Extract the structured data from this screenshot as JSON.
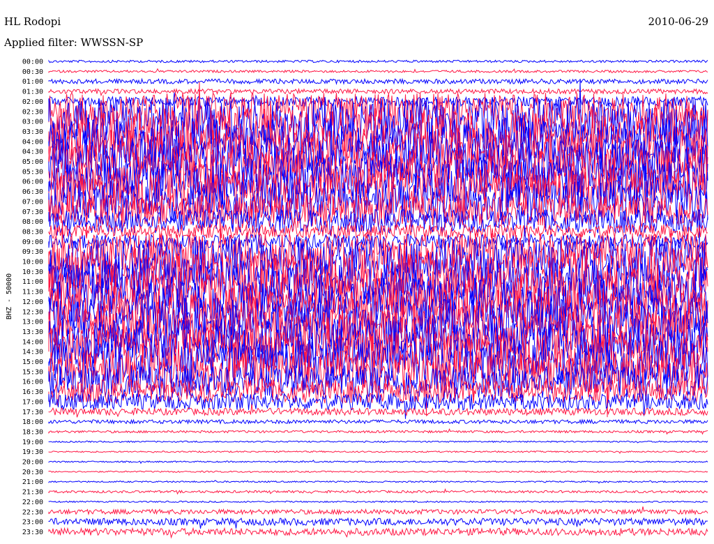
{
  "header": {
    "station": "HL Rodopi",
    "date": "2010-06-29",
    "filter": "Applied filter: WWSSN-SP"
  },
  "chart_data": {
    "type": "line",
    "title": "HL Rodopi",
    "subtitle": "Applied filter: WWSSN-SP",
    "ylabel": "BHZ - 50000",
    "xlabel": "",
    "trace_colors": [
      "#0000ff",
      "#ff1744"
    ],
    "rows": [
      {
        "label": "00:00",
        "level": 0.05,
        "color": "blue"
      },
      {
        "label": "00:30",
        "level": 0.05,
        "color": "red"
      },
      {
        "label": "01:00",
        "level": 0.1,
        "color": "blue"
      },
      {
        "label": "01:30",
        "level": 0.1,
        "color": "red"
      },
      {
        "label": "02:00",
        "level": 0.2,
        "color": "blue"
      },
      {
        "label": "02:30",
        "level": 0.8,
        "color": "red"
      },
      {
        "label": "03:00",
        "level": 1.0,
        "color": "blue"
      },
      {
        "label": "03:30",
        "level": 1.0,
        "color": "red"
      },
      {
        "label": "04:00",
        "level": 1.0,
        "color": "blue"
      },
      {
        "label": "04:30",
        "level": 1.0,
        "color": "red"
      },
      {
        "label": "05:00",
        "level": 1.0,
        "color": "blue"
      },
      {
        "label": "05:30",
        "level": 1.0,
        "color": "red"
      },
      {
        "label": "06:00",
        "level": 1.0,
        "color": "blue"
      },
      {
        "label": "06:30",
        "level": 1.0,
        "color": "red"
      },
      {
        "label": "07:00",
        "level": 0.9,
        "color": "blue"
      },
      {
        "label": "07:30",
        "level": 0.7,
        "color": "red"
      },
      {
        "label": "08:00",
        "level": 0.5,
        "color": "blue"
      },
      {
        "label": "08:30",
        "level": 0.3,
        "color": "red"
      },
      {
        "label": "09:00",
        "level": 0.3,
        "color": "blue"
      },
      {
        "label": "09:30",
        "level": 0.8,
        "color": "red"
      },
      {
        "label": "10:00",
        "level": 1.0,
        "color": "blue"
      },
      {
        "label": "10:30",
        "level": 1.0,
        "color": "red"
      },
      {
        "label": "11:00",
        "level": 1.0,
        "color": "blue"
      },
      {
        "label": "11:30",
        "level": 1.0,
        "color": "red"
      },
      {
        "label": "12:00",
        "level": 1.0,
        "color": "blue"
      },
      {
        "label": "12:30",
        "level": 1.0,
        "color": "red"
      },
      {
        "label": "13:00",
        "level": 1.0,
        "color": "blue"
      },
      {
        "label": "13:30",
        "level": 1.0,
        "color": "red"
      },
      {
        "label": "14:00",
        "level": 1.0,
        "color": "blue"
      },
      {
        "label": "14:30",
        "level": 1.0,
        "color": "red"
      },
      {
        "label": "15:00",
        "level": 1.0,
        "color": "blue"
      },
      {
        "label": "15:30",
        "level": 0.9,
        "color": "red"
      },
      {
        "label": "16:00",
        "level": 0.7,
        "color": "blue"
      },
      {
        "label": "16:30",
        "level": 0.5,
        "color": "red"
      },
      {
        "label": "17:00",
        "level": 0.35,
        "color": "blue"
      },
      {
        "label": "17:30",
        "level": 0.15,
        "color": "red"
      },
      {
        "label": "18:00",
        "level": 0.08,
        "color": "blue"
      },
      {
        "label": "18:30",
        "level": 0.05,
        "color": "red"
      },
      {
        "label": "19:00",
        "level": 0.03,
        "color": "blue"
      },
      {
        "label": "19:30",
        "level": 0.03,
        "color": "red"
      },
      {
        "label": "20:00",
        "level": 0.03,
        "color": "blue"
      },
      {
        "label": "20:30",
        "level": 0.03,
        "color": "red"
      },
      {
        "label": "21:00",
        "level": 0.03,
        "color": "blue"
      },
      {
        "label": "21:30",
        "level": 0.05,
        "color": "red"
      },
      {
        "label": "22:00",
        "level": 0.03,
        "color": "blue"
      },
      {
        "label": "22:30",
        "level": 0.1,
        "color": "red"
      },
      {
        "label": "23:00",
        "level": 0.15,
        "color": "blue"
      },
      {
        "label": "23:30",
        "level": 0.15,
        "color": "red"
      }
    ]
  }
}
